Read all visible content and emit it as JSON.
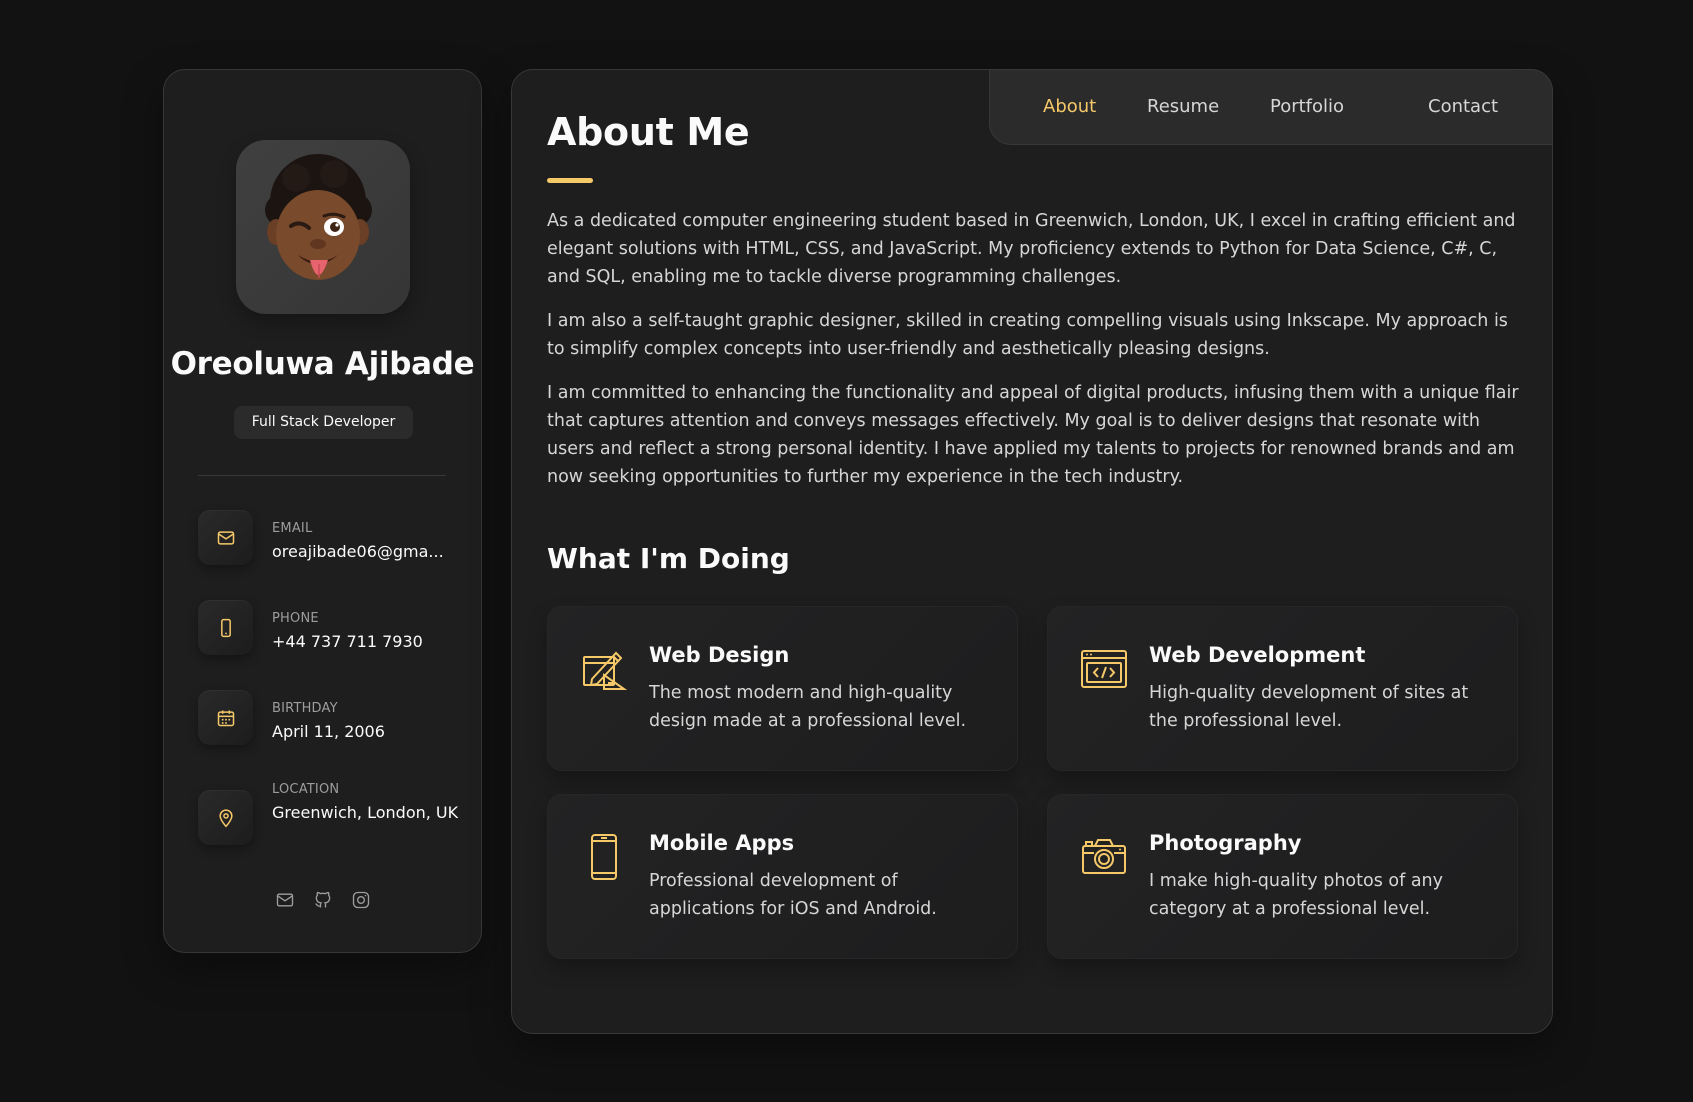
{
  "colors": {
    "accent": "#f5c868",
    "background": "#121212",
    "card": "#1e1e1f",
    "text": "#fafafa",
    "muted": "#d6d6d6"
  },
  "profile": {
    "name": "Oreoluwa Ajibade",
    "title": "Full Stack Developer",
    "avatar_icon": "memoji-avatar-icon"
  },
  "contacts": [
    {
      "icon": "mail-icon",
      "label": "Email",
      "value": "oreajibade06@gma..."
    },
    {
      "icon": "phone-icon",
      "label": "Phone",
      "value": "+44 737 711 7930"
    },
    {
      "icon": "calendar-icon",
      "label": "Birthday",
      "value": "April 11, 2006"
    },
    {
      "icon": "location-pin-icon",
      "label": "Location",
      "value": "Greenwich, London, UK"
    }
  ],
  "socials": [
    "mail-icon",
    "github-icon",
    "instagram-icon"
  ],
  "nav": {
    "items": [
      {
        "label": "About",
        "active": true
      },
      {
        "label": "Resume",
        "active": false
      },
      {
        "label": "Portfolio",
        "active": false
      },
      {
        "label": "Contact",
        "active": false
      }
    ]
  },
  "about": {
    "title": "About Me",
    "paragraphs": [
      "As a dedicated computer engineering student based in Greenwich, London, UK, I excel in crafting efficient and elegant solutions with HTML, CSS, and JavaScript. My proficiency extends to Python for Data Science, C#, C, and SQL, enabling me to tackle diverse programming challenges.",
      "I am also a self-taught graphic designer, skilled in creating compelling visuals using Inkscape. My approach is to simplify complex concepts into user-friendly and aesthetically pleasing designs.",
      "I am committed to enhancing the functionality and appeal of digital products, infusing them with a unique flair that captures attention and conveys messages effectively. My goal is to deliver designs that resonate with users and reflect a strong personal identity. I have applied my talents to projects for renowned brands and am now seeking opportunities to further my experience in the tech industry."
    ]
  },
  "services": {
    "title": "What I'm Doing",
    "items": [
      {
        "icon": "design-pencil-icon",
        "title": "Web Design",
        "text": "The most modern and high-quality design made at a professional level."
      },
      {
        "icon": "code-window-icon",
        "title": "Web Development",
        "text": "High-quality development of sites at the professional level."
      },
      {
        "icon": "mobile-phone-icon",
        "title": "Mobile Apps",
        "text": "Professional development of applications for iOS and Android."
      },
      {
        "icon": "camera-icon",
        "title": "Photography",
        "text": "I make high-quality photos of any category at a professional level."
      }
    ]
  }
}
